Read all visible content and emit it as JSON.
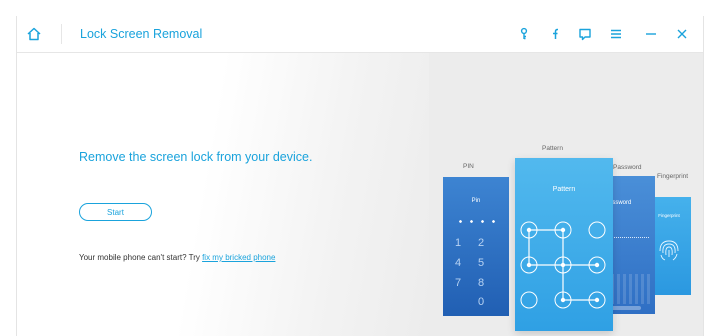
{
  "window": {
    "title": "Lock Screen Removal",
    "icons": [
      "home-icon",
      "key-icon",
      "facebook-icon",
      "feedback-icon",
      "menu-icon",
      "minimize-icon",
      "close-icon"
    ]
  },
  "main": {
    "headline": "Remove the screen lock from your device.",
    "start_label": "Start",
    "help_text": "Your mobile phone can't start? Try ",
    "help_link": "fix my bricked phone"
  },
  "illustration": {
    "labels": {
      "pin": "PIN",
      "pattern": "Pattern",
      "password": "Password",
      "fingerprint": "Fingerprint"
    },
    "cards": {
      "pin": "Pin",
      "pattern": "Pattern",
      "password": "Password",
      "fingerprint": "Fingerprint"
    },
    "pin_keys": [
      "1",
      "2",
      "4",
      "5",
      "7",
      "8",
      "0"
    ]
  },
  "colors": {
    "accent": "#1aa3dc",
    "card_dark": "#2e74c8",
    "card_light": "#4fb4ec"
  }
}
